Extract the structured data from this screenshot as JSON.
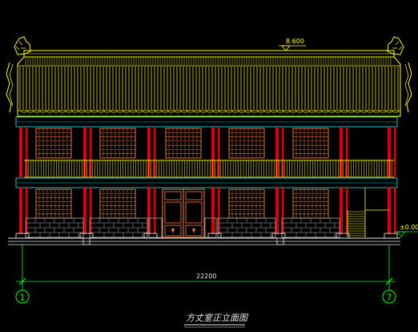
{
  "drawing": {
    "title": "方丈室正立面图",
    "ridge_elevation": "8.600",
    "ground_elevation": "±0.00",
    "overall_dimension": "22200",
    "axis_left": "1",
    "axis_right": "7"
  },
  "colors": {
    "background": "#000000",
    "roof": "#ffff00",
    "beam": "#00c8c8",
    "column": "#e00000",
    "lattice": "#ff8040",
    "masonry": "#b0b0b0",
    "dimension": "#00ff00",
    "text": "#e8e8e8"
  }
}
